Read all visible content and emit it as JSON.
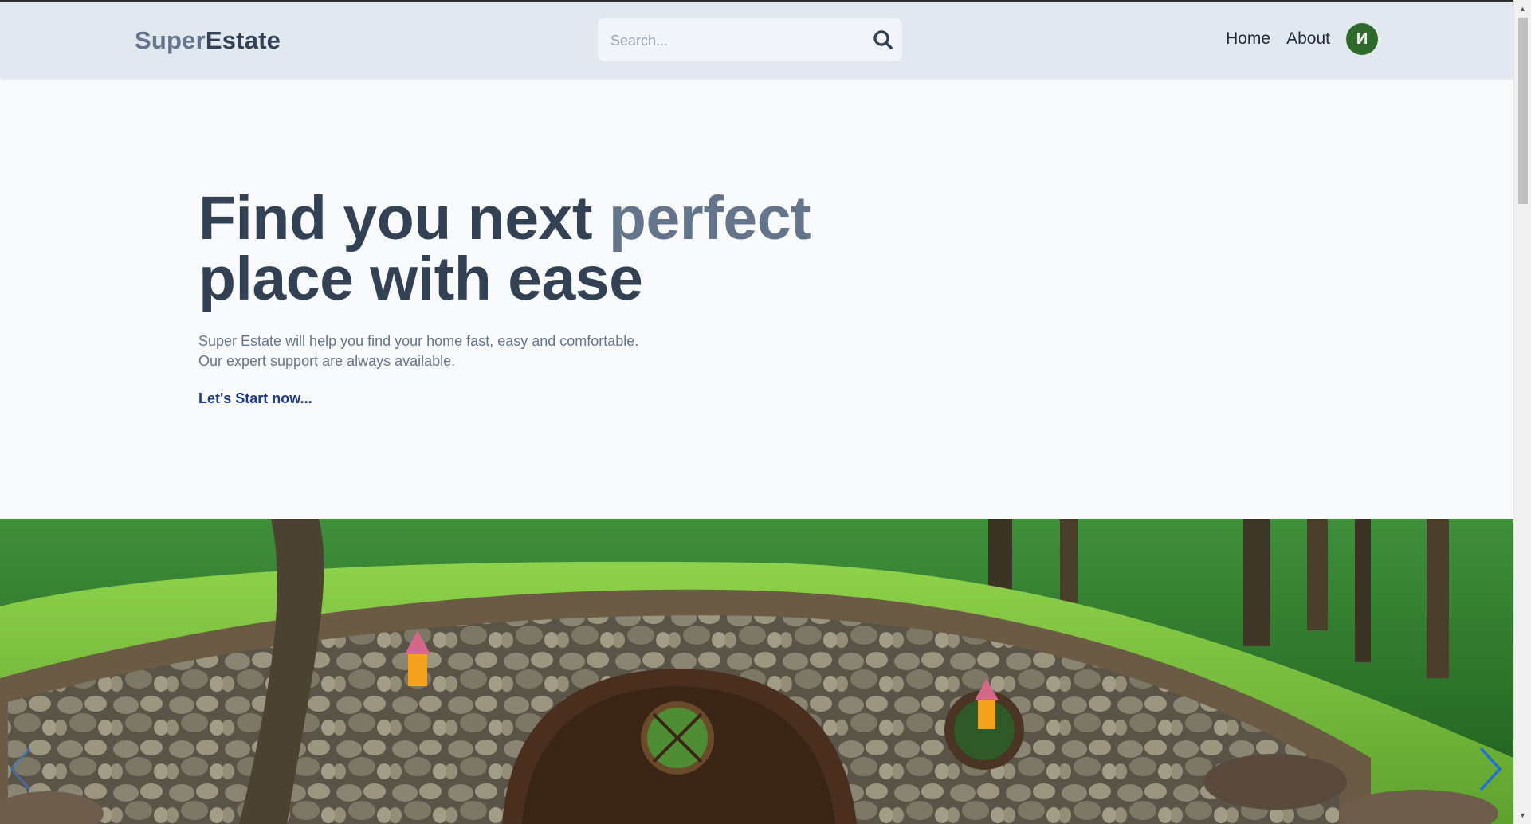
{
  "header": {
    "logo_part1": "Super",
    "logo_part2": "Estate",
    "search_placeholder": "Search...",
    "search_icon": "search-icon",
    "nav": {
      "home": "Home",
      "about": "About"
    },
    "avatar_initial": "И",
    "avatar_color": "#2e6a2b"
  },
  "hero": {
    "title_part1": "Find you next ",
    "title_accent": "perfect",
    "title_part2": "place with ease",
    "subtitle_line1": "Super Estate will help you find your home fast, easy and comfortable.",
    "subtitle_line2": "Our expert support are always available.",
    "cta": "Let's Start now..."
  },
  "carousel": {
    "image": "hobbit-house-with-round-door",
    "prev_icon": "chevron-left-icon",
    "next_icon": "chevron-right-icon"
  },
  "colors": {
    "header_bg": "#e2e8f0",
    "page_bg": "#f8fafc",
    "heading": "#334155",
    "accent": "#64748b",
    "cta": "#1e3a8a"
  }
}
